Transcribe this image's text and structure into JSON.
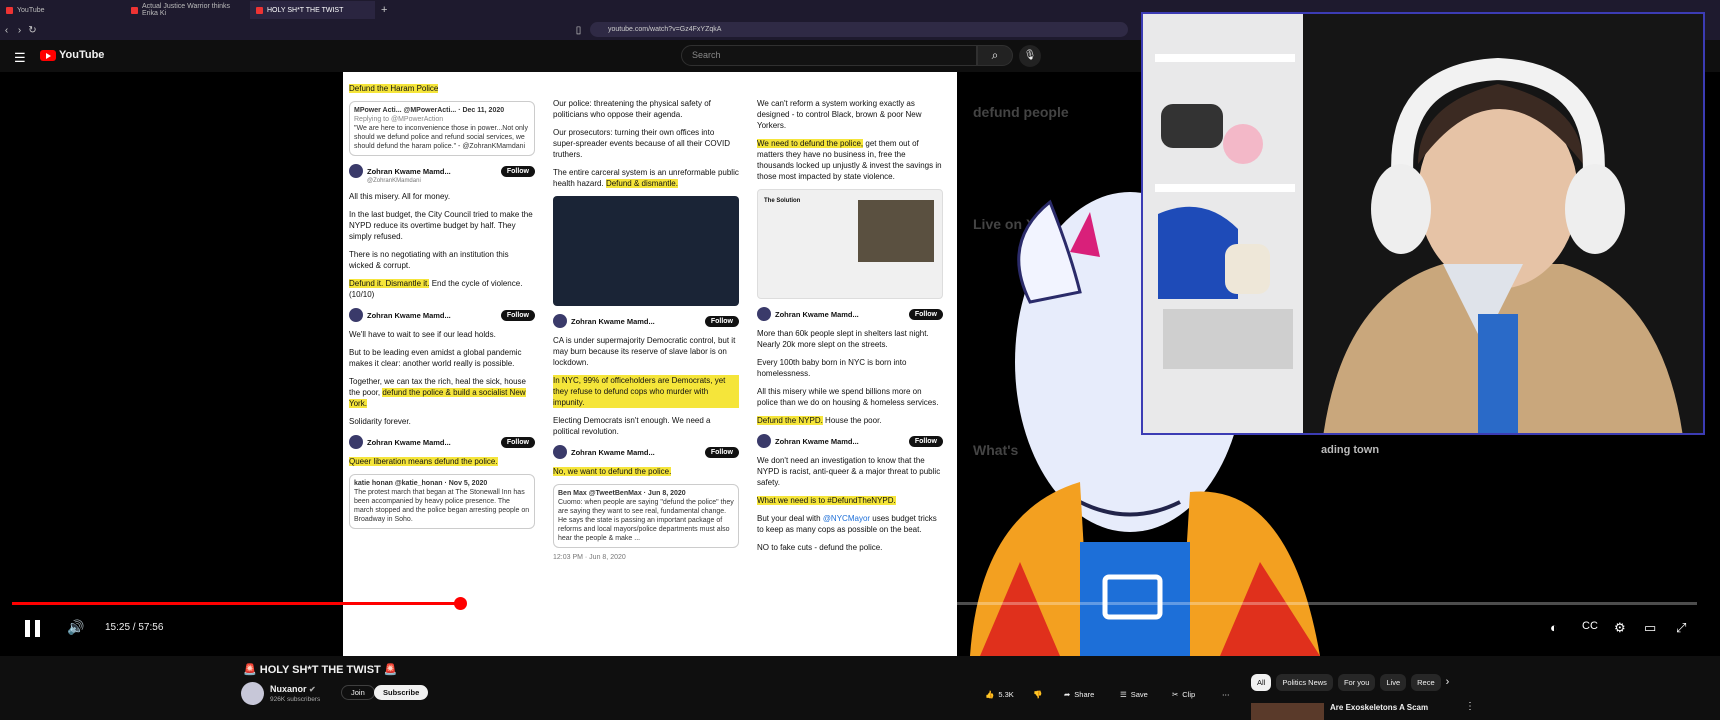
{
  "browser": {
    "tabs": [
      {
        "label": "YouTube",
        "active": false
      },
      {
        "label": "Actual Justice Warrior thinks Erika Ki",
        "active": false
      },
      {
        "label": "HOLY SH*T THE TWIST",
        "active": true
      }
    ],
    "new_tab": "+",
    "address": "youtube.com/watch?v=Gz4FxYZqkA"
  },
  "youtube": {
    "logo_text": "YouTube",
    "search_placeholder": "Search"
  },
  "tweets": {
    "col1": {
      "h1": "Defund the Haram Police",
      "q_author": "MPower Acti... @MPowerActi... · Dec 11, 2020",
      "q_reply": "Replying to @MPowerAction",
      "q_text": "\"We are here to inconvenience those in power...Not only should we defund police and refund social services, we should defund the haram police.\" - @ZohranKMamdani",
      "author": "Zohran Kwame Mamd...",
      "handle": "@ZohranKMamdani",
      "follow": "Follow",
      "p1": "All this misery. All for money.",
      "p2": "In the last budget, the City Council tried to make the NYPD reduce its overtime budget by half. They simply refused.",
      "p3": "There is no negotiating with an institution this wicked & corrupt.",
      "p4a": "Defund it. Dismantle it.",
      "p4b": " End the cycle of violence. (10/10)",
      "p5": "We'll have to wait to see if our lead holds.",
      "p6": "But to be leading even amidst a global pandemic makes it clear: another world really is possible.",
      "p7a": "Together, we can tax the rich, heal the sick, house the poor, ",
      "p7b": "defund the police & build a socialist New York.",
      "p8": "Solidarity forever.",
      "p9": "Queer liberation means defund the police.",
      "q2_author": "katie honan @katie_honan · Nov 5, 2020",
      "q2_text": "The protest march that began at The Stonewall Inn has been accompanied by heavy police presence. The march stopped and the police began arresting people on Broadway in Soho."
    },
    "col2": {
      "p1": "Our police: threatening the physical safety of politicians who oppose their agenda.",
      "p2": "Our prosecutors: turning their own offices into super-spreader events because of all their COVID truthers.",
      "p3a": "The entire carceral system is an unreformable public health hazard. ",
      "p3b": "Defund & dismantle.",
      "p4": "CA is under supermajority Democratic control, but it may burn because its reserve of slave labor is on lockdown.",
      "p5": "In NYC, 99% of officeholders are Democrats, yet they refuse to defund cops who murder with impunity.",
      "p6": "Electing Democrats isn't enough. We need a political revolution.",
      "p7": "No, we want to defund the police.",
      "q_author": "Ben Max @TweetBenMax · Jun 8, 2020",
      "q_text": "Cuomo: when people are saying \"defund the police\" they are saying they want to see real, fundamental change. He says the state is passing an important package of reforms and local mayors/police departments must also hear the people & make ...",
      "time": "12:03 PM · Jun 8, 2020"
    },
    "col3": {
      "p1": "We can't reform a system working exactly as designed - to control Black, brown & poor New Yorkers.",
      "p2a": "We need to defund the police,",
      "p2b": " get them out of matters they have no business in, free the thousands locked up unjustly & invest the savings in those most impacted by state violence.",
      "shot_title": "The Solution",
      "p3": "More than 60k people slept in shelters last night. Nearly 20k more slept on the streets.",
      "p4": "Every 100th baby born in NYC is born into homelessness.",
      "p5": "All this misery while we spend billions more on police than we do on housing & homeless services.",
      "p6a": "Defund the NYPD.",
      "p6b": " House the poor.",
      "p7": "We don't need an investigation to know that the NYPD is racist, anti-queer & a major threat to public safety.",
      "p8": "What we need is to #DefundTheNYPD.",
      "p9a": "But your deal with ",
      "p9b": "@NYCMayor",
      "p9c": " uses budget tricks to keep as many cops as possible on the beat.",
      "p10": "NO to fake cuts - defund the police."
    }
  },
  "dimmed": {
    "t1": "defund people",
    "t2": "Live on X",
    "t3": "What's",
    "t4": "ading town"
  },
  "player": {
    "current_time": "15:25",
    "separator": " / ",
    "duration": "57:56",
    "progress": 0.266
  },
  "video": {
    "title": "🚨 HOLY SH*T THE TWIST 🚨",
    "channel": "Nuxanor",
    "subscribers": "926K subscribers",
    "join": "Join",
    "subscribe": "Subscribe",
    "likes": "5.3K",
    "share": "Share",
    "save": "Save",
    "clip": "Clip"
  },
  "chips": [
    "All",
    "Politics News",
    "For you",
    "Live",
    "Rece"
  ],
  "suggested": {
    "title": "Are Exoskeletons A Scam"
  },
  "colors": {
    "accent": "#ff0000",
    "highlight": "#f5e53a",
    "webcam_border": "#3c3cb4"
  }
}
